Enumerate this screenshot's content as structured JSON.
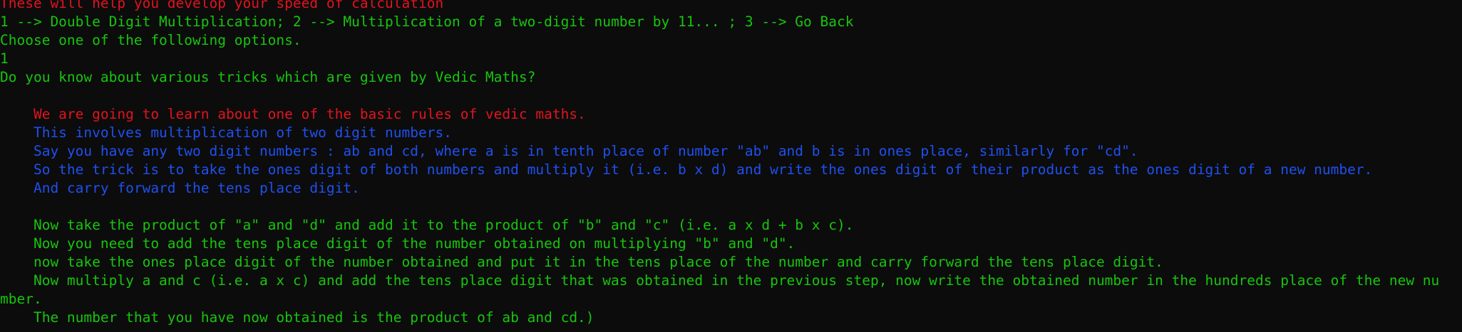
{
  "terminal": {
    "colors": {
      "background": "#0c0c0c",
      "green": "#16c60c",
      "red": "#e1141e",
      "blue": "#1f50f0"
    },
    "lines": [
      "These will help you develop your speed of calculation",
      "1 --> Double Digit Multiplication; 2 --> Multiplication of a two-digit number by 11... ; 3 --> Go Back",
      "Choose one of the following options.",
      "1",
      "Do you know about various tricks which are given by Vedic Maths?",
      "",
      "    We are going to learn about one of the basic rules of vedic maths.",
      "    This involves multiplication of two digit numbers.",
      "    Say you have any two digit numbers : ab and cd, where a is in tenth place of number \"ab\" and b is in ones place, similarly for \"cd\".",
      "    So the trick is to take the ones digit of both numbers and multiply it (i.e. b x d) and write the ones digit of their product as the ones digit of a new number.",
      "    And carry forward the tens place digit.",
      "",
      "    Now take the product of \"a\" and \"d\" and add it to the product of \"b\" and \"c\" (i.e. a x d + b x c).",
      "    Now you need to add the tens place digit of the number obtained on multiplying \"b\" and \"d\".",
      "    now take the ones place digit of the number obtained and put it in the tens place of the number and carry forward the tens place digit.",
      "    Now multiply a and c (i.e. a x c) and add the tens place digit that was obtained in the previous step, now write the obtained number in the hundreds place of the new nu",
      "mber.",
      "    The number that you have now obtained is the product of ab and cd.)"
    ]
  }
}
